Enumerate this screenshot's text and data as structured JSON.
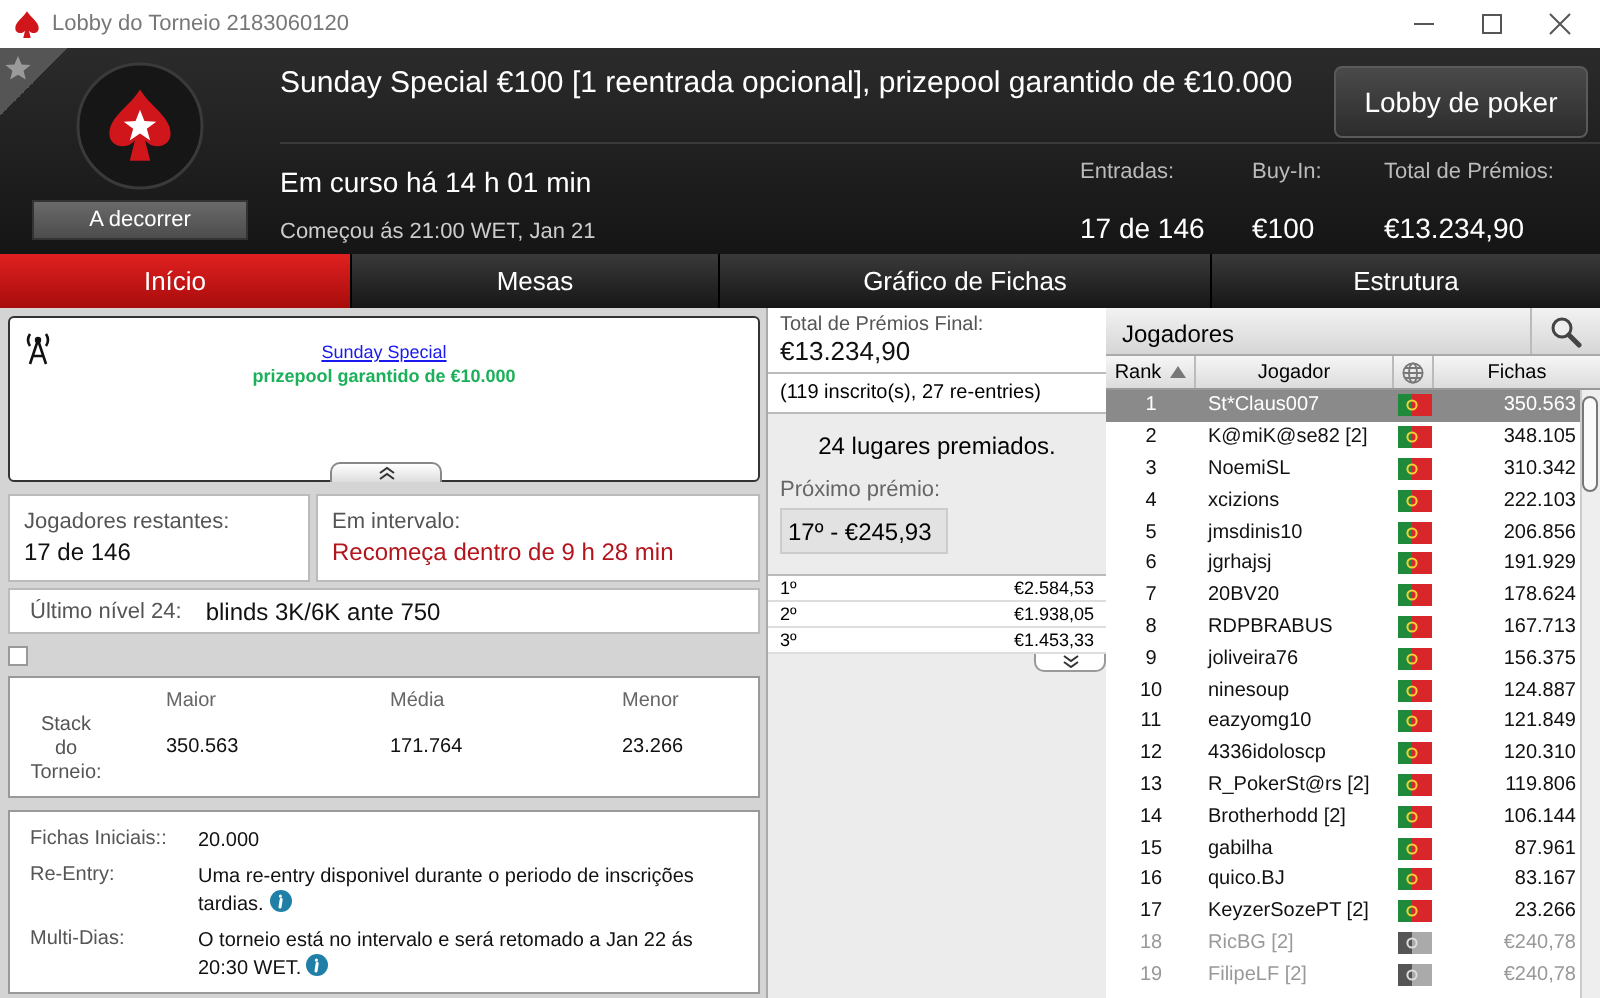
{
  "window": {
    "title": "Lobby do Torneio 2183060120"
  },
  "header": {
    "title": "Sunday Special €100 [1 reentrada opcional], prizepool garantido de €10.000",
    "lobby_button": "Lobby de poker",
    "status": "Em curso há 14 h 01 min",
    "started": "Começou ás 21:00 WET, Jan 21",
    "badge": "A decorrer",
    "stats": [
      {
        "label": "Entradas:",
        "value": "17 de 146"
      },
      {
        "label": "Buy-In:",
        "value": "€100"
      },
      {
        "label": "Total de Prémios:",
        "value": "€13.234,90"
      }
    ]
  },
  "tabs": [
    {
      "label": "Início",
      "selected": true
    },
    {
      "label": "Mesas",
      "selected": false
    },
    {
      "label": "Gráfico de Fichas",
      "selected": false
    },
    {
      "label": "Estrutura",
      "selected": false
    }
  ],
  "news": {
    "link": "Sunday Special",
    "subtitle": "prizepool garantido de €10.000"
  },
  "players_left": {
    "label": "Jogadores restantes:",
    "value": "17 de 146"
  },
  "break": {
    "label": "Em intervalo:",
    "value": "Recomeça dentro de 9 h 28 min"
  },
  "last_level": {
    "label": "Último nível 24:",
    "value": "blinds 3K/6K ante 750"
  },
  "checkbox": {
    "checked": false
  },
  "stack": {
    "label": "Stack do Torneio:",
    "columns": [
      {
        "label": "Maior",
        "value": "350.563"
      },
      {
        "label": "Média",
        "value": "171.764"
      },
      {
        "label": "Menor",
        "value": "23.266"
      }
    ]
  },
  "details": [
    {
      "label": "Fichas Iniciais::",
      "value": "20.000",
      "info": false
    },
    {
      "label": "Re-Entry:",
      "value": "Uma re-entry disponivel durante o periodo de inscrições tardias.",
      "info": true
    },
    {
      "label": "Multi-Dias:",
      "value": "O torneio está no intervalo e será retomado a Jan 22 ás 20:30 WET.",
      "info": true
    }
  ],
  "prizes": {
    "total_label": "Total de Prémios Final:",
    "total_value": "€13.234,90",
    "entries_note": "(119 inscrito(s), 27 re-entries)",
    "places": "24 lugares premiados.",
    "next_label": "Próximo prémio:",
    "next_value": "17º - €245,93",
    "list": [
      {
        "place": "1º",
        "amount": "€2.584,53"
      },
      {
        "place": "2º",
        "amount": "€1.938,05"
      },
      {
        "place": "3º",
        "amount": "€1.453,33"
      }
    ]
  },
  "players": {
    "title": "Jogadores",
    "columns": [
      "Rank",
      "Jogador",
      "Fichas"
    ],
    "rows": [
      {
        "rank": "1",
        "name": "St*Claus007",
        "chips": "350.563",
        "selected": true,
        "eliminated": false
      },
      {
        "rank": "2",
        "name": "K@miK@se82 [2]",
        "chips": "348.105",
        "selected": false,
        "eliminated": false
      },
      {
        "rank": "3",
        "name": "NoemiSL",
        "chips": "310.342",
        "selected": false,
        "eliminated": false
      },
      {
        "rank": "4",
        "name": "xcizions",
        "chips": "222.103",
        "selected": false,
        "eliminated": false
      },
      {
        "rank": "5",
        "name": "jmsdinis10",
        "chips": "206.856",
        "selected": false,
        "eliminated": false
      },
      {
        "rank": "6",
        "name": "jgrhajsj",
        "chips": "191.929",
        "selected": false,
        "eliminated": false
      },
      {
        "rank": "7",
        "name": "20BV20",
        "chips": "178.624",
        "selected": false,
        "eliminated": false
      },
      {
        "rank": "8",
        "name": "RDPBRABUS",
        "chips": "167.713",
        "selected": false,
        "eliminated": false
      },
      {
        "rank": "9",
        "name": "joliveira76",
        "chips": "156.375",
        "selected": false,
        "eliminated": false
      },
      {
        "rank": "10",
        "name": "ninesoup",
        "chips": "124.887",
        "selected": false,
        "eliminated": false
      },
      {
        "rank": "11",
        "name": "eazyomg10",
        "chips": "121.849",
        "selected": false,
        "eliminated": false
      },
      {
        "rank": "12",
        "name": "4336idoloscp",
        "chips": "120.310",
        "selected": false,
        "eliminated": false
      },
      {
        "rank": "13",
        "name": "R_PokerSt@rs [2]",
        "chips": "119.806",
        "selected": false,
        "eliminated": false
      },
      {
        "rank": "14",
        "name": "Brotherhodd [2]",
        "chips": "106.144",
        "selected": false,
        "eliminated": false
      },
      {
        "rank": "15",
        "name": "gabilha",
        "chips": "87.961",
        "selected": false,
        "eliminated": false
      },
      {
        "rank": "16",
        "name": "quico.BJ",
        "chips": "83.167",
        "selected": false,
        "eliminated": false
      },
      {
        "rank": "17",
        "name": "KeyzerSozePT [2]",
        "chips": "23.266",
        "selected": false,
        "eliminated": false
      },
      {
        "rank": "18",
        "name": "RicBG [2]",
        "chips": "€240,78",
        "selected": false,
        "eliminated": true
      },
      {
        "rank": "19",
        "name": "FilipeLF [2]",
        "chips": "€240,78",
        "selected": false,
        "eliminated": true
      }
    ]
  }
}
